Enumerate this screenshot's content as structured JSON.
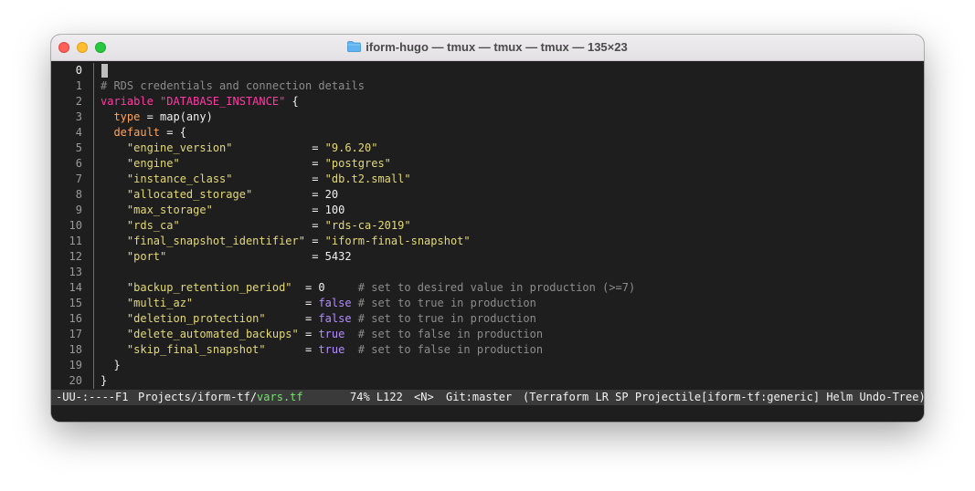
{
  "window": {
    "title": "iform-hugo — tmux — tmux — tmux — 135×23"
  },
  "editor": {
    "lines": [
      {
        "n": "0",
        "parts": []
      },
      {
        "n": "1",
        "parts": [
          {
            "t": "# RDS credentials and connection details",
            "c": "comment"
          }
        ]
      },
      {
        "n": "2",
        "parts": [
          {
            "t": "variable",
            "c": "kw"
          },
          {
            "t": " ",
            "c": "plain"
          },
          {
            "t": "\"DATABASE_INSTANCE\"",
            "c": "kw"
          },
          {
            "t": " {",
            "c": "plain"
          }
        ]
      },
      {
        "n": "3",
        "parts": [
          {
            "t": "  ",
            "c": "plain"
          },
          {
            "t": "type",
            "c": "attr"
          },
          {
            "t": " = map(any)",
            "c": "plain"
          }
        ]
      },
      {
        "n": "4",
        "parts": [
          {
            "t": "  ",
            "c": "plain"
          },
          {
            "t": "default",
            "c": "attr"
          },
          {
            "t": " = {",
            "c": "plain"
          }
        ]
      },
      {
        "n": "5",
        "parts": [
          {
            "t": "    ",
            "c": "plain"
          },
          {
            "t": "\"engine_version\"",
            "c": "str"
          },
          {
            "t": "            = ",
            "c": "plain"
          },
          {
            "t": "\"9.6.20\"",
            "c": "str"
          }
        ]
      },
      {
        "n": "6",
        "parts": [
          {
            "t": "    ",
            "c": "plain"
          },
          {
            "t": "\"engine\"",
            "c": "str"
          },
          {
            "t": "                    = ",
            "c": "plain"
          },
          {
            "t": "\"postgres\"",
            "c": "str"
          }
        ]
      },
      {
        "n": "7",
        "parts": [
          {
            "t": "    ",
            "c": "plain"
          },
          {
            "t": "\"instance_class\"",
            "c": "str"
          },
          {
            "t": "            = ",
            "c": "plain"
          },
          {
            "t": "\"db.t2.small\"",
            "c": "str"
          }
        ]
      },
      {
        "n": "8",
        "parts": [
          {
            "t": "    ",
            "c": "plain"
          },
          {
            "t": "\"allocated_storage\"",
            "c": "str"
          },
          {
            "t": "         = 20",
            "c": "plain"
          }
        ]
      },
      {
        "n": "9",
        "parts": [
          {
            "t": "    ",
            "c": "plain"
          },
          {
            "t": "\"max_storage\"",
            "c": "str"
          },
          {
            "t": "               = 100",
            "c": "plain"
          }
        ]
      },
      {
        "n": "10",
        "parts": [
          {
            "t": "    ",
            "c": "plain"
          },
          {
            "t": "\"rds_ca\"",
            "c": "str"
          },
          {
            "t": "                    = ",
            "c": "plain"
          },
          {
            "t": "\"rds-ca-2019\"",
            "c": "str"
          }
        ]
      },
      {
        "n": "11",
        "parts": [
          {
            "t": "    ",
            "c": "plain"
          },
          {
            "t": "\"final_snapshot_identifier\"",
            "c": "str"
          },
          {
            "t": " = ",
            "c": "plain"
          },
          {
            "t": "\"iform-final-snapshot\"",
            "c": "str"
          }
        ]
      },
      {
        "n": "12",
        "parts": [
          {
            "t": "    ",
            "c": "plain"
          },
          {
            "t": "\"port\"",
            "c": "str"
          },
          {
            "t": "                      = 5432",
            "c": "plain"
          }
        ]
      },
      {
        "n": "13",
        "parts": []
      },
      {
        "n": "14",
        "parts": [
          {
            "t": "    ",
            "c": "plain"
          },
          {
            "t": "\"backup_retention_period\"",
            "c": "str"
          },
          {
            "t": "  = 0     ",
            "c": "plain"
          },
          {
            "t": "# set to desired value in production (>=7)",
            "c": "comment"
          }
        ]
      },
      {
        "n": "15",
        "parts": [
          {
            "t": "    ",
            "c": "plain"
          },
          {
            "t": "\"multi_az\"",
            "c": "str"
          },
          {
            "t": "                 = ",
            "c": "plain"
          },
          {
            "t": "false",
            "c": "bool"
          },
          {
            "t": " ",
            "c": "plain"
          },
          {
            "t": "# set to true in production",
            "c": "comment"
          }
        ]
      },
      {
        "n": "16",
        "parts": [
          {
            "t": "    ",
            "c": "plain"
          },
          {
            "t": "\"deletion_protection\"",
            "c": "str"
          },
          {
            "t": "      = ",
            "c": "plain"
          },
          {
            "t": "false",
            "c": "bool"
          },
          {
            "t": " ",
            "c": "plain"
          },
          {
            "t": "# set to true in production",
            "c": "comment"
          }
        ]
      },
      {
        "n": "17",
        "parts": [
          {
            "t": "    ",
            "c": "plain"
          },
          {
            "t": "\"delete_automated_backups\"",
            "c": "str"
          },
          {
            "t": " = ",
            "c": "plain"
          },
          {
            "t": "true",
            "c": "bool"
          },
          {
            "t": "  ",
            "c": "plain"
          },
          {
            "t": "# set to false in production",
            "c": "comment"
          }
        ]
      },
      {
        "n": "18",
        "parts": [
          {
            "t": "    ",
            "c": "plain"
          },
          {
            "t": "\"skip_final_snapshot\"",
            "c": "str"
          },
          {
            "t": "      = ",
            "c": "plain"
          },
          {
            "t": "true",
            "c": "bool"
          },
          {
            "t": "  ",
            "c": "plain"
          },
          {
            "t": "# set to false in production",
            "c": "comment"
          }
        ]
      },
      {
        "n": "19",
        "parts": [
          {
            "t": "  }",
            "c": "plain"
          }
        ]
      },
      {
        "n": "20",
        "parts": [
          {
            "t": "}",
            "c": "plain"
          }
        ]
      }
    ]
  },
  "modeline": {
    "status": "-UU-:----F1",
    "path": "Projects/iform-tf/",
    "file": "vars.tf",
    "position": "74% L122",
    "state": "<N>",
    "git": "Git:master",
    "modes": "(Terraform LR SP Projectile[iform-tf:generic] Helm Undo-Tree)"
  },
  "colors": {
    "background": "#1e1e1e",
    "keyword": "#ff3aa5",
    "string": "#e3d977",
    "attribute": "#ffa45a",
    "boolean": "#b38cff",
    "comment": "#8c8c8c",
    "filename": "#74e26b"
  }
}
